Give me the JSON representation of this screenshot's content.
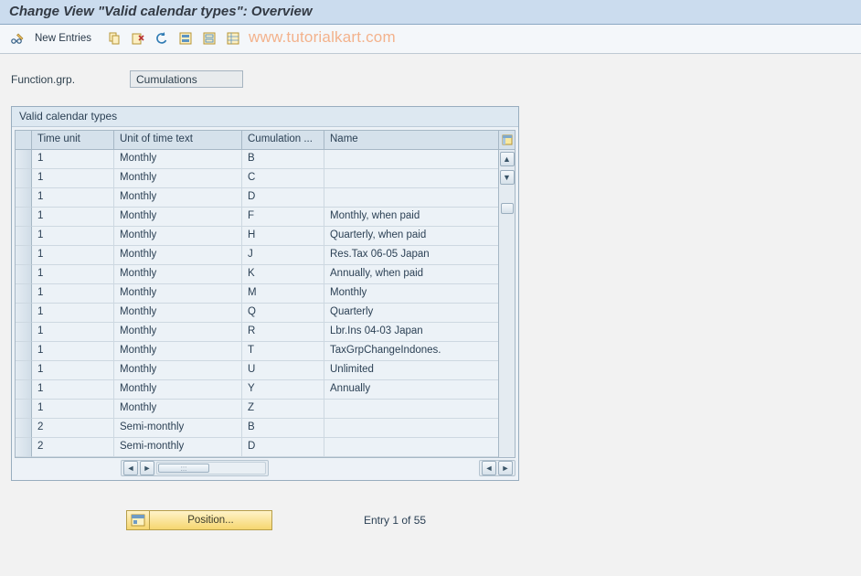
{
  "title": "Change View \"Valid calendar types\": Overview",
  "toolbar": {
    "new_entries_label": "New Entries"
  },
  "watermark": "www.tutorialkart.com",
  "form": {
    "function_grp_label": "Function.grp.",
    "function_grp_value": "Cumulations"
  },
  "panel": {
    "title": "Valid calendar types",
    "columns": {
      "time_unit": "Time unit",
      "unit_text": "Unit of time text",
      "cumulation": "Cumulation ...",
      "name": "Name"
    },
    "rows": [
      {
        "time": "1",
        "unit": "Monthly",
        "cum": "B",
        "name": ""
      },
      {
        "time": "1",
        "unit": "Monthly",
        "cum": "C",
        "name": ""
      },
      {
        "time": "1",
        "unit": "Monthly",
        "cum": "D",
        "name": ""
      },
      {
        "time": "1",
        "unit": "Monthly",
        "cum": "F",
        "name": "Monthly, when paid"
      },
      {
        "time": "1",
        "unit": "Monthly",
        "cum": "H",
        "name": "Quarterly, when paid"
      },
      {
        "time": "1",
        "unit": "Monthly",
        "cum": "J",
        "name": "Res.Tax 06-05  Japan"
      },
      {
        "time": "1",
        "unit": "Monthly",
        "cum": "K",
        "name": "Annually, when paid"
      },
      {
        "time": "1",
        "unit": "Monthly",
        "cum": "M",
        "name": "Monthly"
      },
      {
        "time": "1",
        "unit": "Monthly",
        "cum": "Q",
        "name": "Quarterly"
      },
      {
        "time": "1",
        "unit": "Monthly",
        "cum": "R",
        "name": "Lbr.Ins 04-03  Japan"
      },
      {
        "time": "1",
        "unit": "Monthly",
        "cum": "T",
        "name": "TaxGrpChangeIndones."
      },
      {
        "time": "1",
        "unit": "Monthly",
        "cum": "U",
        "name": "Unlimited"
      },
      {
        "time": "1",
        "unit": "Monthly",
        "cum": "Y",
        "name": "Annually"
      },
      {
        "time": "1",
        "unit": "Monthly",
        "cum": "Z",
        "name": ""
      },
      {
        "time": "2",
        "unit": "Semi-monthly",
        "cum": "B",
        "name": ""
      },
      {
        "time": "2",
        "unit": "Semi-monthly",
        "cum": "D",
        "name": ""
      }
    ]
  },
  "footer": {
    "position_label": "Position...",
    "entry_status": "Entry 1 of 55"
  }
}
